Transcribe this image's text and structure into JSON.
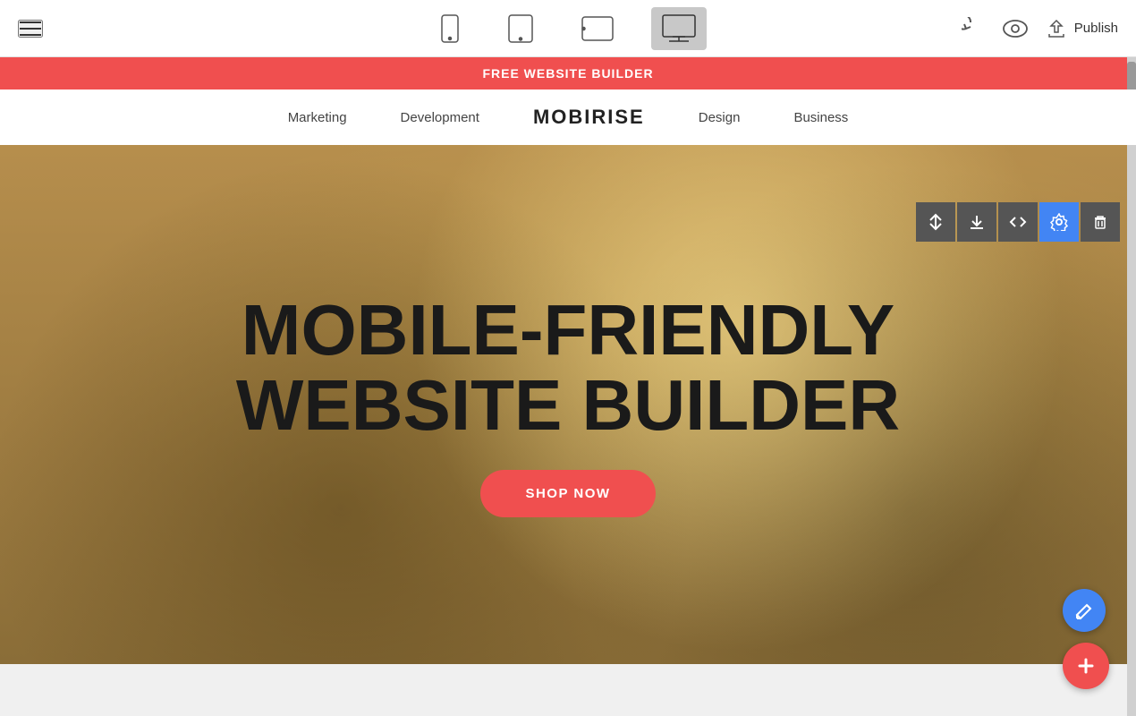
{
  "toolbar": {
    "devices": [
      {
        "id": "mobile",
        "label": "Mobile view",
        "icon": "mobile-icon"
      },
      {
        "id": "tablet",
        "label": "Tablet view",
        "icon": "tablet-icon"
      },
      {
        "id": "tablet-landscape",
        "label": "Tablet landscape view",
        "icon": "tablet-landscape-icon"
      },
      {
        "id": "desktop",
        "label": "Desktop view",
        "icon": "desktop-icon",
        "active": true
      }
    ],
    "undo_label": "Undo",
    "preview_label": "Preview",
    "publish_label": "Publish"
  },
  "site": {
    "banner_text": "FREE WEBSITE BUILDER",
    "nav": {
      "brand": "MOBIRISE",
      "links": [
        "Marketing",
        "Development",
        "Design",
        "Business"
      ]
    },
    "hero": {
      "title_line1": "MOBILE-FRIENDLY",
      "title_line2": "WEBSITE BUILDER",
      "cta_label": "SHOP NOW"
    }
  },
  "block_toolbar": {
    "buttons": [
      {
        "id": "move",
        "icon": "move-icon",
        "active": false
      },
      {
        "id": "download",
        "icon": "download-icon",
        "active": false
      },
      {
        "id": "code",
        "icon": "code-icon",
        "active": false
      },
      {
        "id": "settings",
        "icon": "settings-icon",
        "active": true
      },
      {
        "id": "delete",
        "icon": "trash-icon",
        "active": false
      }
    ]
  },
  "fabs": {
    "edit_label": "Edit",
    "add_label": "Add block"
  }
}
